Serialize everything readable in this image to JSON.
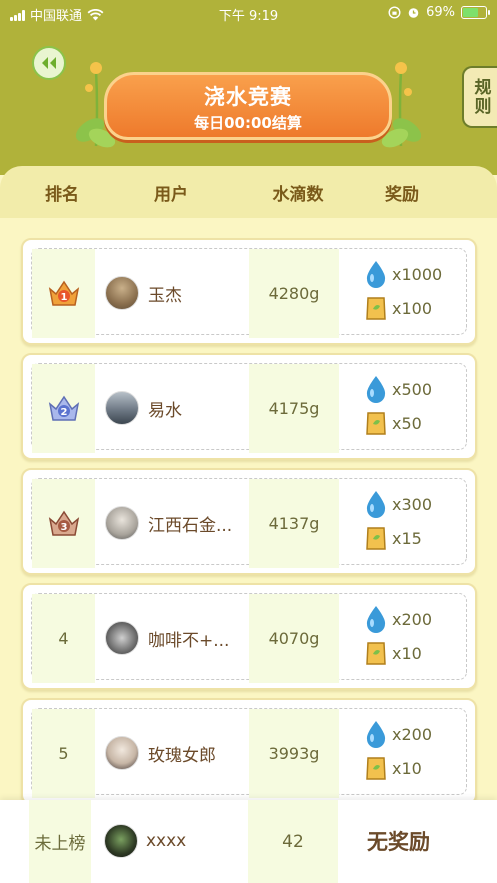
{
  "status_bar": {
    "carrier": "中国联通",
    "time": "下午 9:19",
    "battery": "69%",
    "battery_level": 0.69
  },
  "banner": {
    "title": "浇水竞赛",
    "subtitle": "每日00:00结算"
  },
  "rules_label": "规则",
  "columns": {
    "rank": "排名",
    "user": "用户",
    "water": "水滴数",
    "reward": "奖励"
  },
  "rows": [
    {
      "rank": "1",
      "medal": "gold-crown",
      "name": "玉杰",
      "water": "4280g",
      "drops": "x1000",
      "fertilizer": "x100",
      "avatar_color": "#8a6f4e"
    },
    {
      "rank": "2",
      "medal": "silver-crown",
      "name": "易水",
      "water": "4175g",
      "drops": "x500",
      "fertilizer": "x50",
      "avatar_color": "#7d8794"
    },
    {
      "rank": "3",
      "medal": "bronze-crown",
      "name": "江西石金...",
      "water": "4137g",
      "drops": "x300",
      "fertilizer": "x15",
      "avatar_color": "#a8a39b"
    },
    {
      "rank": "4",
      "name": "咖啡不+...",
      "water": "4070g",
      "drops": "x200",
      "fertilizer": "x10",
      "avatar_color": "#6e6e6e"
    },
    {
      "rank": "5",
      "name": "玫瑰女郎",
      "water": "3993g",
      "drops": "x200",
      "fertilizer": "x10",
      "avatar_color": "#c7b6a6"
    }
  ],
  "self": {
    "rank": "未上榜",
    "name": "xxxx",
    "water": "42",
    "reward": "无奖励"
  },
  "colors": {
    "header_bg": "#b0b23a",
    "page_bg": "#fbf6c3",
    "accent_orange": "#ee7a2c",
    "drop_blue": "#3a9ad9"
  }
}
